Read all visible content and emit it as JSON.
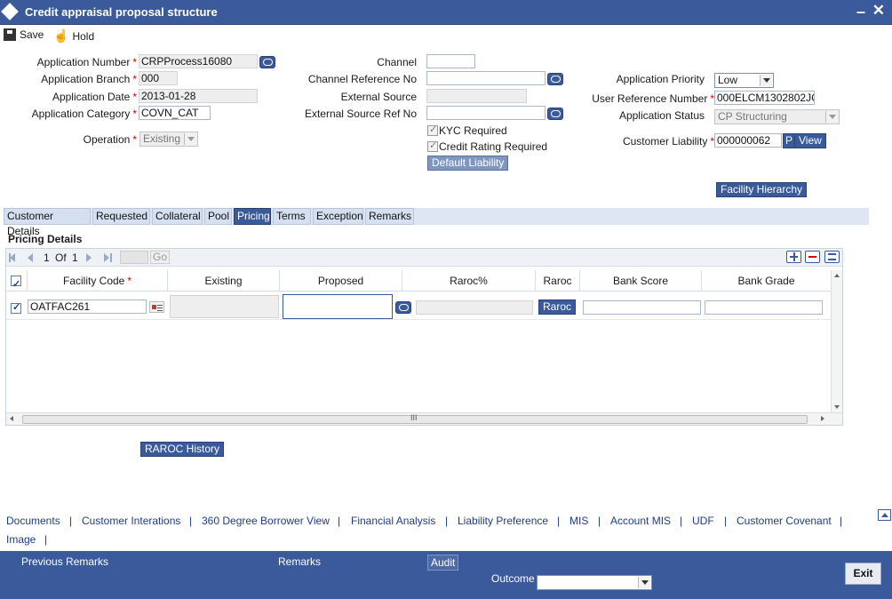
{
  "window": {
    "title": "Credit appraisal proposal structure",
    "minimize": "–",
    "close": "✕"
  },
  "toolbar": {
    "save_label": "Save",
    "hold_label": "Hold"
  },
  "form": {
    "application_number": {
      "label": "Application Number",
      "value": "CRPProcess16080"
    },
    "application_branch": {
      "label": "Application Branch",
      "value": "000"
    },
    "application_date": {
      "label": "Application Date",
      "value": "2013-01-28"
    },
    "application_category": {
      "label": "Application Category",
      "value": "COVN_CAT"
    },
    "operation": {
      "label": "Operation",
      "value": "Existing"
    },
    "channel": {
      "label": "Channel",
      "value": ""
    },
    "channel_reference_no": {
      "label": "Channel Reference No",
      "value": ""
    },
    "external_source": {
      "label": "External Source",
      "value": ""
    },
    "external_source_ref_no": {
      "label": "External Source Ref No",
      "value": ""
    },
    "kyc_required": {
      "label": "KYC Required",
      "checked": true
    },
    "credit_rating_required": {
      "label": "Credit Rating Required",
      "checked": true
    },
    "default_liability_label": "Default Liability",
    "application_priority": {
      "label": "Application Priority",
      "value": "Low"
    },
    "user_reference_number": {
      "label": "User Reference Number",
      "value": "000ELCM1302802JG"
    },
    "application_status": {
      "label": "Application Status",
      "value": "CP Structuring"
    },
    "customer_liability": {
      "label": "Customer Liability",
      "value": "000000062",
      "p_label": "P",
      "view_label": "View"
    },
    "facility_hierarchy_label": "Facility Hierarchy",
    "required_mark": "*"
  },
  "tabs": [
    {
      "label": "Customer Details",
      "active": false
    },
    {
      "label": "Requested",
      "active": false
    },
    {
      "label": "Collateral",
      "active": false
    },
    {
      "label": "Pool",
      "active": false
    },
    {
      "label": "Pricing",
      "active": true
    },
    {
      "label": "Terms",
      "active": false
    },
    {
      "label": "Exception",
      "active": false
    },
    {
      "label": "Remarks",
      "active": false
    }
  ],
  "pricing": {
    "section_title": "Pricing Details",
    "pager": {
      "page": "1",
      "of_label": "Of",
      "total": "1",
      "go_label": "Go"
    },
    "columns": [
      "Facility Code",
      "Existing",
      "Proposed",
      "Raroc%",
      "Raroc",
      "Bank Score",
      "Bank Grade"
    ],
    "rows": [
      {
        "selected": true,
        "facility_code": "OATFAC261",
        "existing": "",
        "proposed": "",
        "raroc_pct": "",
        "raroc_button": "Raroc",
        "bank_score": "",
        "bank_grade": ""
      }
    ],
    "scroll_thumb_label": "III"
  },
  "raroc_history_label": "RAROC History",
  "links_row1": [
    "Documents",
    "Customer Interations",
    "360 Degree Borrower View",
    "Financial Analysis",
    "Liability Preference",
    "MIS",
    "Account MIS",
    "UDF",
    "Customer Covenant"
  ],
  "links_row2": [
    "Image"
  ],
  "link_separator": "|",
  "footer": {
    "previous_remarks_label": "Previous Remarks",
    "remarks_label": "Remarks",
    "audit_label": "Audit",
    "outcome_label": "Outcome",
    "outcome_value": "",
    "exit_label": "Exit"
  },
  "colors": {
    "brand": "#3a5a9c",
    "tab_bg": "#d4dff0",
    "link": "#1e3c8c",
    "required": "#cc0000"
  }
}
